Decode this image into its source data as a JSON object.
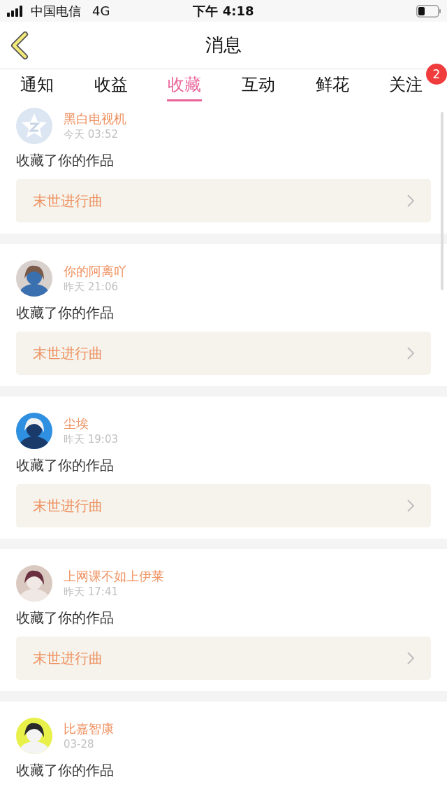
{
  "status_bar": {
    "carrier": "中国电信",
    "network": "4G",
    "time": "下午 4:18"
  },
  "nav": {
    "title": "消息"
  },
  "tabs": [
    {
      "label": "通知",
      "selected": false
    },
    {
      "label": "收益",
      "selected": false
    },
    {
      "label": "收藏",
      "selected": true
    },
    {
      "label": "互动",
      "selected": false
    },
    {
      "label": "鲜花",
      "selected": false
    },
    {
      "label": "关注",
      "selected": false,
      "badge": "2"
    }
  ],
  "messages": [
    {
      "kind": "default",
      "name": "黑白电视机",
      "time": "今天 03:52",
      "text": "收藏了你的作品",
      "work": "末世进行曲"
    },
    {
      "kind": "picture",
      "name": "你的阿离吖",
      "time": "昨天 21:06",
      "text": "收藏了你的作品",
      "work": "末世进行曲"
    },
    {
      "kind": "picture",
      "name": "尘埃",
      "time": "昨天 19:03",
      "text": "收藏了你的作品",
      "work": "末世进行曲"
    },
    {
      "kind": "picture",
      "name": "上网课不如上伊莱",
      "time": "昨天 17:41",
      "text": "收藏了你的作品",
      "work": "末世进行曲"
    },
    {
      "kind": "picture",
      "name": "比嘉智康",
      "time": "03-28",
      "text": "收藏了你的作品"
    }
  ]
}
